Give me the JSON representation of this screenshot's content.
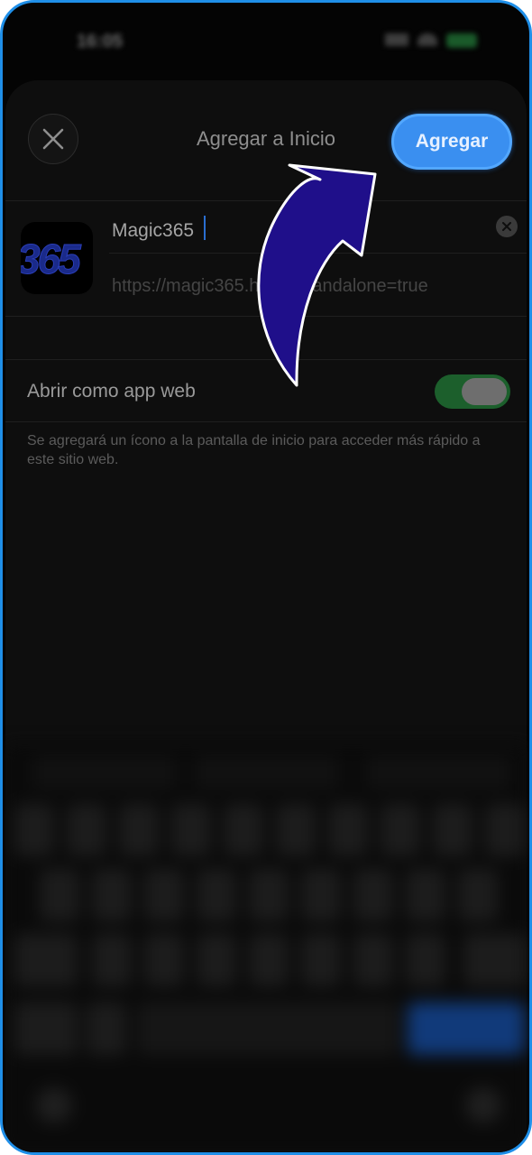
{
  "sheet": {
    "title": "Agregar a Inicio",
    "add_label": "Agregar"
  },
  "app": {
    "icon_text": "365",
    "name_value": "Magic365",
    "url": "https://magic365.host/?standalone=true"
  },
  "settings": {
    "webapp_label": "Abrir como app web",
    "webapp_on": true,
    "description": "Se agregará un ícono a la pantalla de inicio para acceder más rápido a este sitio web."
  },
  "colors": {
    "accent": "#3a8ff0",
    "toggle_on": "#1c5f2c",
    "arrow_fill": "#1f0f8a",
    "frame": "#1f8fe8"
  },
  "icons": [
    "close-icon",
    "clear-text-icon",
    "arrow-pointer-icon"
  ]
}
